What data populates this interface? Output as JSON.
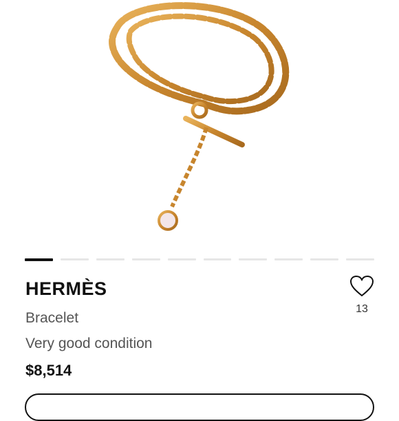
{
  "product": {
    "brand": "HERMÈS",
    "category": "Bracelet",
    "condition": "Very good condition",
    "price": "$8,514",
    "likes": "13"
  },
  "carousel": {
    "total": 10,
    "active_index": 0
  },
  "icons": {
    "like": "heart-outline-icon"
  },
  "colors": {
    "gold": "#c8943e",
    "text": "#111111",
    "muted": "#555555"
  }
}
